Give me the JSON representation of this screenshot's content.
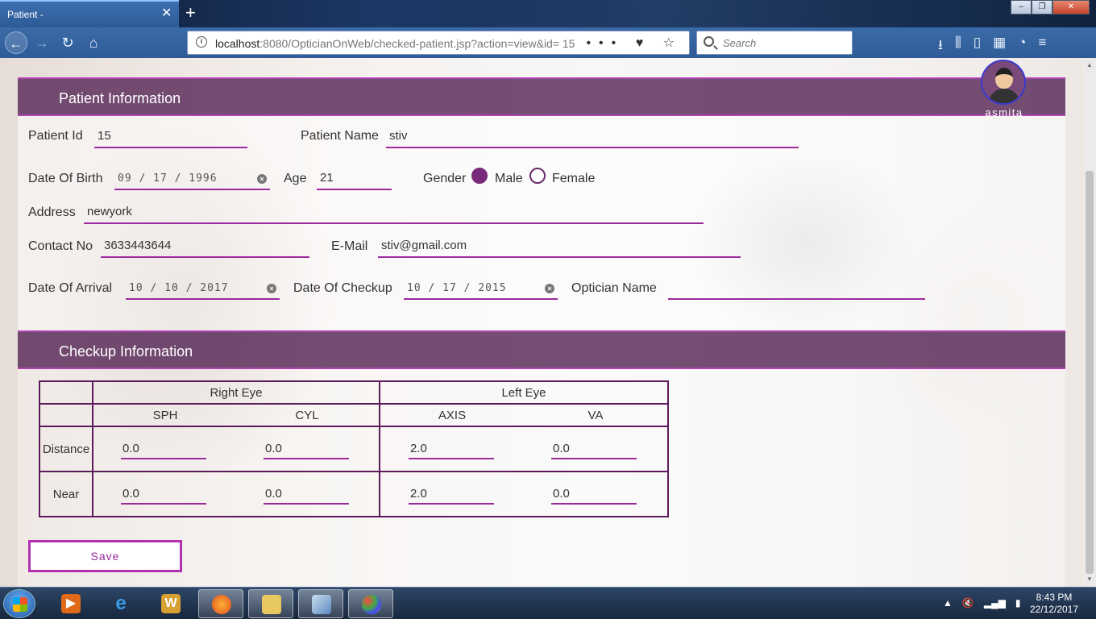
{
  "browser": {
    "tab_title": "Patient -",
    "tab_close": "✕",
    "new_tab": "+",
    "url_host": "localhost",
    "url_rest": ":8080/OpticianOnWeb/checked-patient.jsp?action=view&id= 15",
    "url_actions": "••• ♥ ☆",
    "search_placeholder": "Search",
    "win_minimize": "–",
    "win_maximize": "❐",
    "win_close": "✕"
  },
  "user": {
    "name": "asmita"
  },
  "patient_section": {
    "title": "Patient Information",
    "patient_id_label": "Patient Id",
    "patient_id": "15",
    "patient_name_label": "Patient Name",
    "patient_name": "stiv",
    "dob_label": "Date Of Birth",
    "dob": "09 / 17 / 1996",
    "age_label": "Age",
    "age": "21",
    "gender_label": "Gender",
    "gender_male": "Male",
    "gender_female": "Female",
    "gender_selected": "Male",
    "address_label": "Address",
    "address": "newyork",
    "contact_label": "Contact No",
    "contact": "3633443644",
    "email_label": "E-Mail",
    "email": "stiv@gmail.com",
    "arrival_label": "Date Of Arrival",
    "arrival": "10 / 10 / 2017",
    "checkup_label": "Date Of Checkup",
    "checkup": "10 / 17 / 2015",
    "optician_label": "Optician Name",
    "optician": ""
  },
  "checkup_section": {
    "title": "Checkup Information",
    "right_eye": "Right Eye",
    "left_eye": "Left Eye",
    "columns": [
      "SPH",
      "CYL",
      "AXIS",
      "VA"
    ],
    "rows": [
      {
        "label": "Distance",
        "values": [
          "0.0",
          "0.0",
          "2.0",
          "0.0"
        ]
      },
      {
        "label": "Near",
        "values": [
          "0.0",
          "0.0",
          "2.0",
          "0.0"
        ]
      }
    ]
  },
  "save_label": "Save",
  "taskbar": {
    "time": "8:43 PM",
    "date": "22/12/2017"
  }
}
